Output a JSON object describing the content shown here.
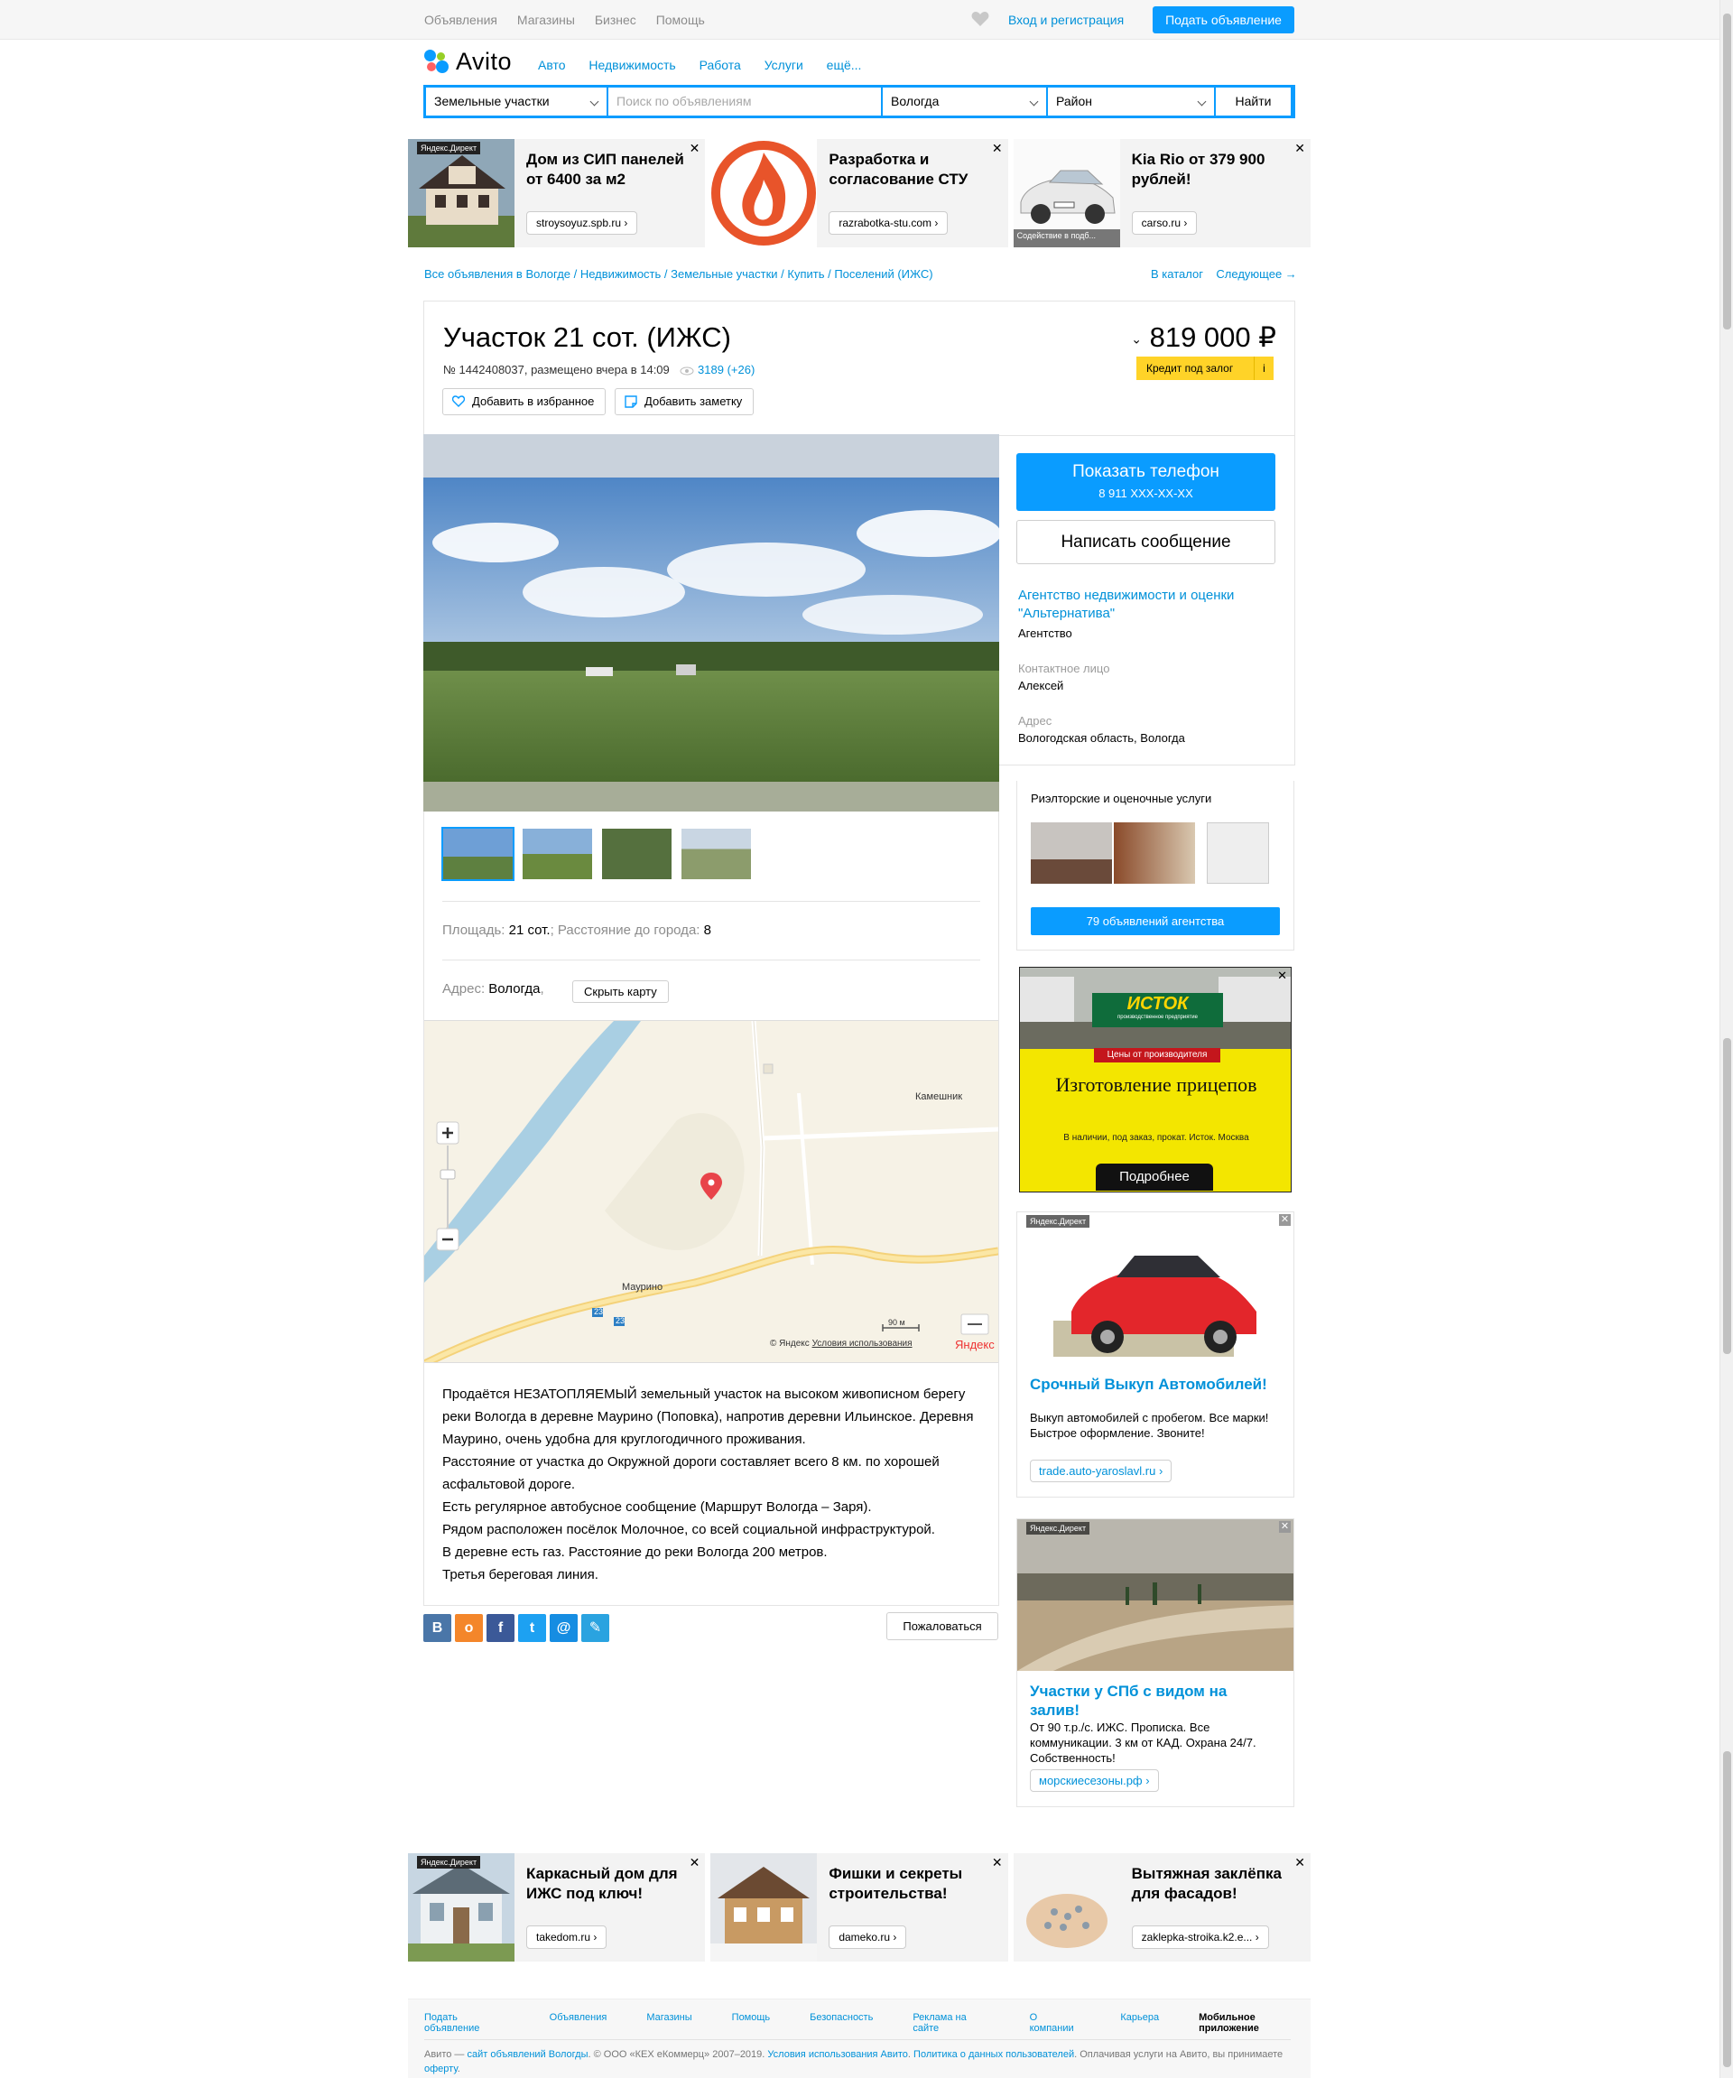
{
  "topbar": {
    "nav": [
      "Объявления",
      "Магазины",
      "Бизнес",
      "Помощь"
    ],
    "login": "Вход и регистрация",
    "post_button": "Подать объявление"
  },
  "header": {
    "logo": "Avito",
    "nav": [
      "Авто",
      "Недвижимость",
      "Работа",
      "Услуги",
      "ещё..."
    ]
  },
  "search": {
    "category": "Земельные участки",
    "placeholder": "Поиск по объявлениям",
    "city": "Вологда",
    "district": "Район",
    "button": "Найти"
  },
  "top_ads": [
    {
      "title": "Дом из СИП панелей от 6400 за м2",
      "domain": "stroysoyuz.spb.ru ›",
      "tag": "Яндекс.Директ"
    },
    {
      "title": "Разработка и согласование СТУ",
      "domain": "razrabotka-stu.com ›",
      "tag": ""
    },
    {
      "title": "Kia Rio от 379 900 рублей!",
      "domain": "carso.ru ›",
      "tag": "",
      "note": "Содействие в подб..."
    }
  ],
  "breadcrumbs": "Все объявления в Вологде / Недвижимость / Земельные участки / Купить / Поселений (ИЖС)",
  "crumb_nav": {
    "catalog": "В каталог",
    "next": "Следующее →"
  },
  "listing": {
    "title": "Участок 21 сот. (ИЖС)",
    "meta": "№ 1442408037, размещено вчера в 14:09",
    "views": "3189 (+26)",
    "favorite": "Добавить в избранное",
    "note": "Добавить заметку",
    "price": "819 000 ₽",
    "credit": "Кредит под залог",
    "credit_info": "i",
    "params_label_1": "Площадь:",
    "params_value_1": "21 сот.",
    "params_label_2": "; Расстояние до города:",
    "params_value_2": "8",
    "address_label": "Адрес:",
    "address_value": "Вологда",
    "hide_map": "Скрыть карту",
    "description": [
      "Продаётся НЕЗАТОПЛЯЕМЫЙ земельный участок на высоком живописном берегу реки Вологда в деревне Маурино (Поповка), напротив деревни Ильинское. Деревня Маурино, очень удобна для круглогодичного проживания.",
      "Расстояние от участка до Окружной дороги составляет всего 8 км. по хорошей асфальтовой дороге.",
      "Есть регулярное автобусное сообщение (Маршрут Вологда – Заря).",
      "Рядом расположен посёлок Молочное, со всей социальной инфраструктурой.",
      "В деревне есть газ. Расстояние до реки Вологда 200 метров.",
      "Третья береговая линия."
    ],
    "complain": "Пожаловаться"
  },
  "map": {
    "labels": [
      "Камешник",
      "Маурино"
    ],
    "road": "23",
    "scale": "90 м",
    "copyright": "© Яндекс",
    "terms": "Условия использования",
    "brand": "Яндекс"
  },
  "seller": {
    "phone_button": "Показать телефон",
    "phone_masked": "8 911 XXX-XX-XX",
    "message_button": "Написать сообщение",
    "name": "Агентство недвижимости и оценки \"Альтернатива\"",
    "type": "Агентство",
    "contact_label": "Контактное лицо",
    "contact": "Алексей",
    "address_label": "Адрес",
    "address": "Вологодская область, Вологда"
  },
  "agency": {
    "title": "Риэлторские и оценочные услуги",
    "button": "79 объявлений агентства"
  },
  "banner": {
    "brand": "ИСТОК",
    "brand_sub": "производственное предприятие",
    "tag": "Цены от производителя",
    "title": "Изготовление прицепов",
    "text": "В наличии, под заказ, прокат. Исток. Москва",
    "button": "Подробнее"
  },
  "side_ads": [
    {
      "tag": "Яндекс.Директ",
      "title": "Срочный Выкуп Автомобилей!",
      "text": "Выкуп автомобилей с пробегом. Все марки! Быстрое оформление. Звоните!",
      "domain": "trade.auto-yaroslavl.ru ›"
    },
    {
      "tag": "Яндекс.Директ",
      "title": "Участки у СПб с видом на залив!",
      "text": "От 90 т.р./с. ИЖС. Прописка. Все коммуникации. 3 км от КАД. Охрана 24/7. Собственность!",
      "domain": "морскиесезоны.рф ›"
    }
  ],
  "bottom_ads": [
    {
      "title": "Каркасный дом для ИЖС под ключ!",
      "domain": "takedom.ru ›",
      "tag": "Яндекс.Директ"
    },
    {
      "title": "Фишки и секреты строительства!",
      "domain": "dameko.ru ›",
      "tag": ""
    },
    {
      "title": "Вытяжная заклёпка для фасадов!",
      "domain": "zaklepka-stroika.k2.e... ›",
      "tag": ""
    }
  ],
  "footer": {
    "links": [
      "Подать объявление",
      "Объявления",
      "Магазины",
      "Помощь",
      "Безопасность",
      "Реклама на сайте",
      "О компании",
      "Карьера"
    ],
    "mobile": "Мобильное приложение",
    "copy_1": "Авито — ",
    "copy_link": "сайт объявлений Вологды",
    "copy_2": ". © ООО «КЕХ еКоммерц» 2007–2019. ",
    "copy_terms": "Условия использования Авито",
    "copy_3": ". ",
    "copy_policy": "Политика о данных пользователей",
    "copy_4": ". Оплачивая услуги на Авито, вы принимаете ",
    "copy_offer": "оферту",
    "copy_5": "."
  }
}
